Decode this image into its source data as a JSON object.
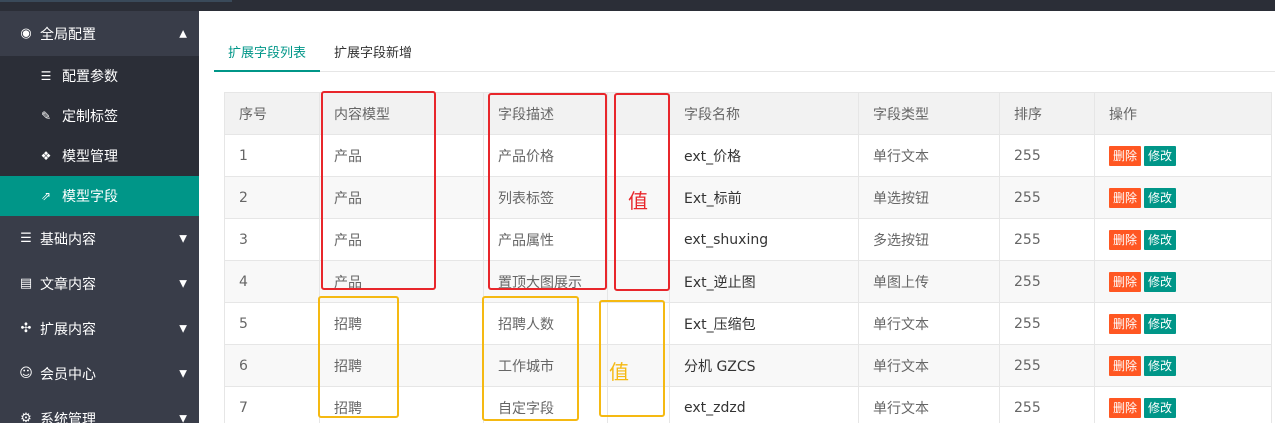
{
  "sidebar": {
    "group_main": {
      "label": "全局配置",
      "icon": "globe-icon"
    },
    "sub_items": [
      {
        "label": "配置参数",
        "icon": "sliders-icon"
      },
      {
        "label": "定制标签",
        "icon": "wrench-icon"
      },
      {
        "label": "模型管理",
        "icon": "cube-icon"
      },
      {
        "label": "模型字段",
        "icon": "external-link-icon",
        "active": true
      }
    ],
    "groups": [
      {
        "label": "基础内容",
        "icon": "sliders-icon"
      },
      {
        "label": "文章内容",
        "icon": "file-icon"
      },
      {
        "label": "扩展内容",
        "icon": "expand-icon"
      },
      {
        "label": "会员中心",
        "icon": "user-icon"
      },
      {
        "label": "系统管理",
        "icon": "gear-icon"
      }
    ]
  },
  "tabs": [
    {
      "label": "扩展字段列表",
      "active": true
    },
    {
      "label": "扩展字段新增",
      "active": false
    }
  ],
  "table": {
    "headers": [
      "序号",
      "内容模型",
      "字段描述",
      "",
      "字段名称",
      "字段类型",
      "排序",
      "操作"
    ],
    "rows": [
      {
        "id": "1",
        "model": "产品",
        "desc": "产品价格",
        "name": "ext_价格",
        "type": "单行文本",
        "sort": "255"
      },
      {
        "id": "2",
        "model": "产品",
        "desc": "列表标签",
        "name": "Ext_标前",
        "type": "单选按钮",
        "sort": "255"
      },
      {
        "id": "3",
        "model": "产品",
        "desc": "产品属性",
        "name": "ext_shuxing",
        "type": "多选按钮",
        "sort": "255"
      },
      {
        "id": "4",
        "model": "产品",
        "desc": "置顶大图展示",
        "name": "Ext_逆止图",
        "type": "单图上传",
        "sort": "255"
      },
      {
        "id": "5",
        "model": "招聘",
        "desc": "招聘人数",
        "name": "Ext_压缩包",
        "type": "单行文本",
        "sort": "255"
      },
      {
        "id": "6",
        "model": "招聘",
        "desc": "工作城市",
        "name": "分机 GZCS",
        "type": "单行文本",
        "sort": "255"
      },
      {
        "id": "7",
        "model": "招聘",
        "desc": "自定字段",
        "name": "ext_zdzd",
        "type": "单行文本",
        "sort": "255"
      }
    ],
    "delete_label": "删除",
    "edit_label": "修改"
  },
  "annotations": {
    "red_note": "值",
    "yellow_note": "值",
    "red_color": "#e8262b",
    "yellow_color": "#f5b912"
  },
  "colors": {
    "accent": "#009688",
    "danger": "#ff5722",
    "sidebar_bg": "#393d49"
  }
}
